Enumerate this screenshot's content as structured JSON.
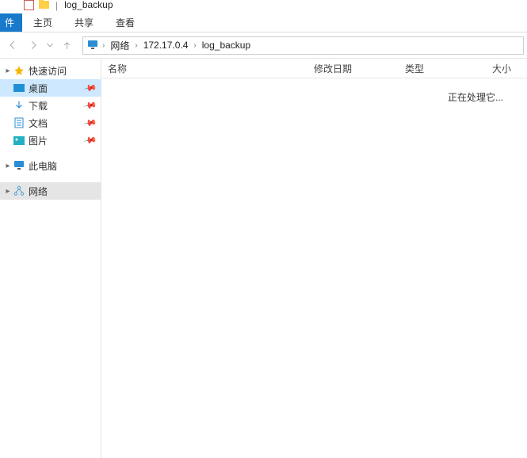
{
  "window": {
    "title_separator": "|",
    "title_text": "log_backup"
  },
  "ribbon": {
    "file": "件",
    "tabs": [
      "主页",
      "共享",
      "查看"
    ]
  },
  "nav": {
    "crumbs": [
      "网络",
      "172.17.0.4",
      "log_backup"
    ]
  },
  "sidebar": {
    "quick_access": "快速访问",
    "items": [
      {
        "label": "桌面",
        "pinned": true,
        "selected": true
      },
      {
        "label": "下载",
        "pinned": true,
        "selected": false
      },
      {
        "label": "文档",
        "pinned": true,
        "selected": false
      },
      {
        "label": "图片",
        "pinned": true,
        "selected": false
      }
    ],
    "this_pc": "此电脑",
    "network": "网络"
  },
  "columns": {
    "name": "名称",
    "date": "修改日期",
    "type": "类型",
    "size": "大小"
  },
  "content": {
    "status": "正在处理它..."
  }
}
